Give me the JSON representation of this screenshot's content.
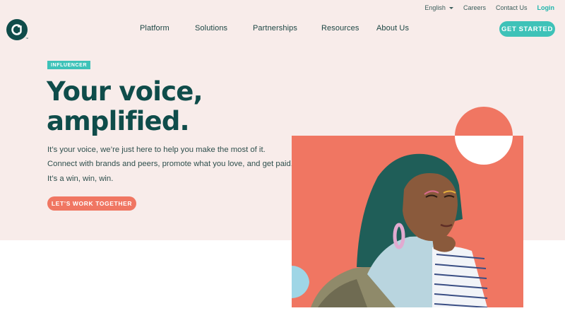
{
  "header": {
    "language": "English",
    "utility_links": [
      "Careers",
      "Contact Us"
    ],
    "login": "Login",
    "nav": [
      "Platform",
      "Solutions",
      "Partnerships",
      "Resources",
      "About Us"
    ],
    "cta": "GET STARTED",
    "logo_text": "CJ"
  },
  "hero": {
    "badge": "INFLUENCER",
    "headline_1": "Your voice,",
    "headline_2": "amplified.",
    "body": [
      "It’s your voice, we’re just here to help you make the most of it.",
      "Connect with brands and peers, promote what you love, and get paid.",
      "It’s a win, win, win."
    ],
    "cta": "LET’S WORK TOGETHER"
  },
  "colors": {
    "teal_dark": "#0f4c4a",
    "teal_accent": "#3ec2b8",
    "coral": "#f07662",
    "blush_bg": "#f8ecea",
    "sky": "#9fd6e6"
  },
  "icons": {
    "language_caret": "caret-down-icon",
    "logo": "cj-logo-icon"
  }
}
